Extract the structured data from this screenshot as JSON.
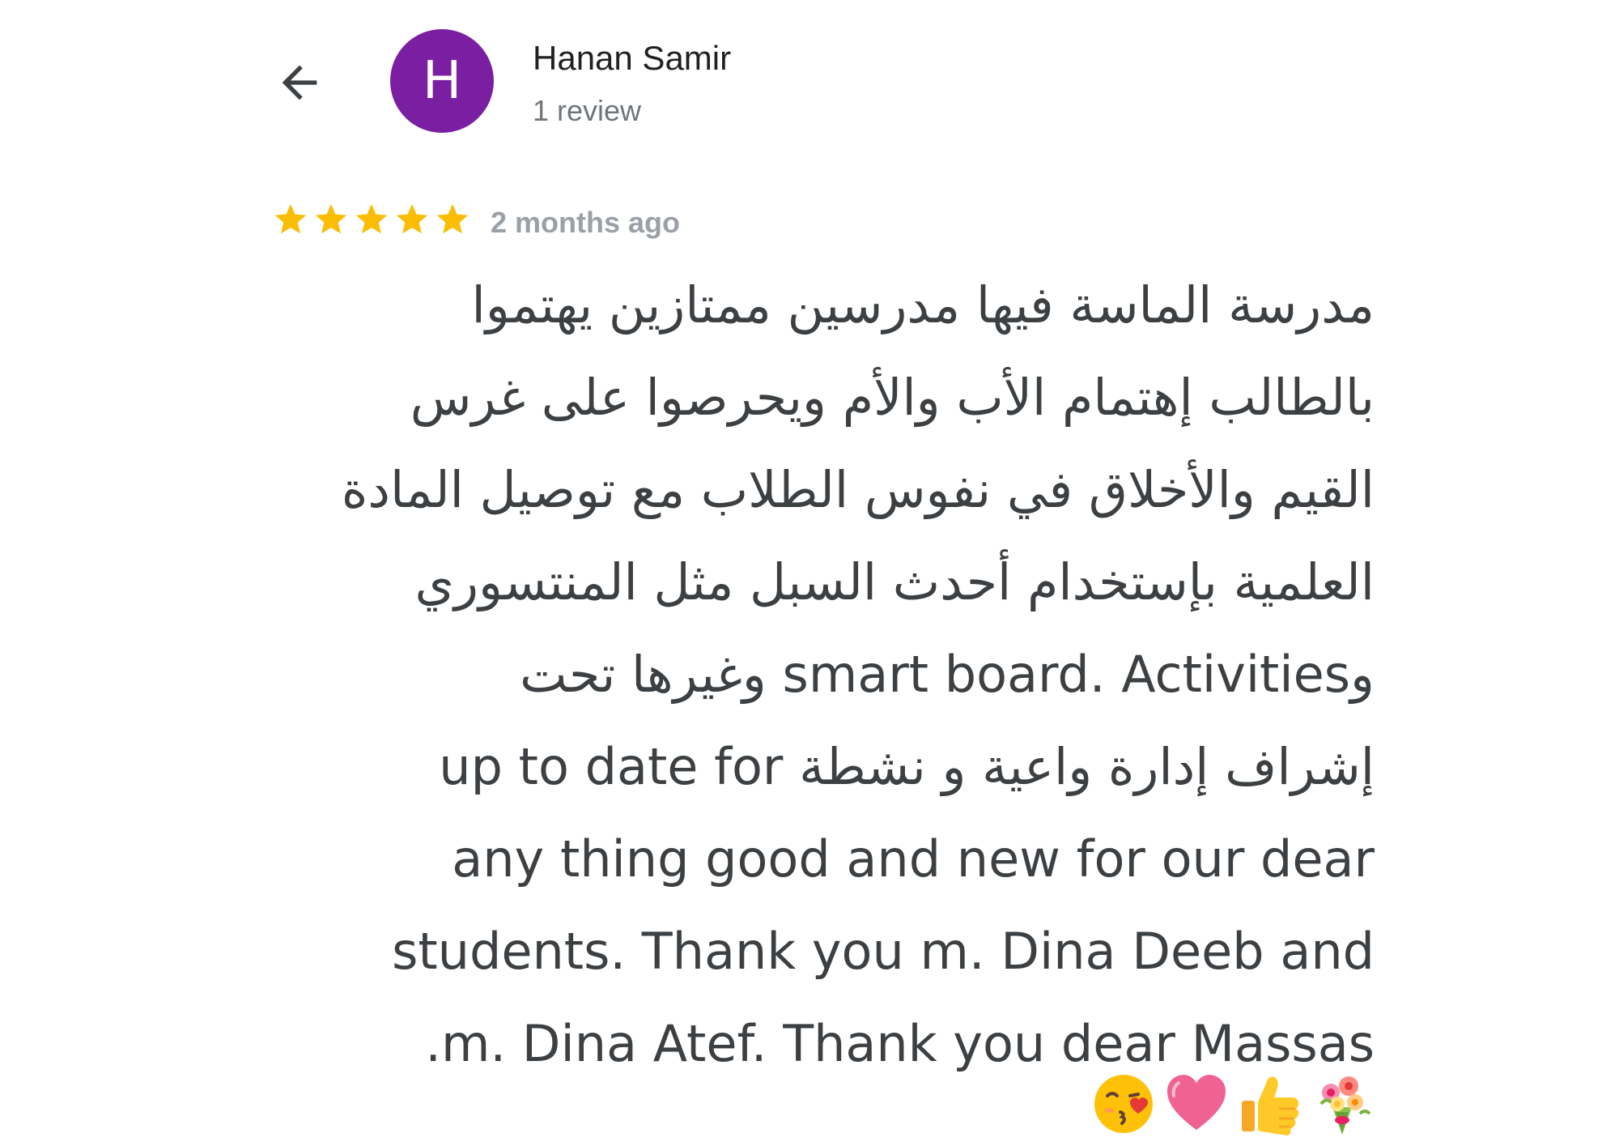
{
  "header": {
    "back_icon": "arrow-left-icon",
    "avatar_letter": "H",
    "avatar_color": "#7b1fa2",
    "reviewer_name": "Hanan Samir",
    "review_count": "1 review"
  },
  "review": {
    "rating": 5,
    "rating_max": 5,
    "star_color": "#fbbc04",
    "time": "2 months ago",
    "lines": [
      "مدرسة الماسة فيها مدرسين ممتازين يهتموا",
      "بالطالب إهتمام الأب والأم ويحرصوا على غرس",
      "القيم والأخلاق في نفوس الطلاب مع توصيل المادة",
      "العلمية بإستخدام أحدث السبل مثل المنتسوري",
      "وsmart board. Activities وغيرها تحت",
      "إشراف إدارة واعية و نشطة up to date for",
      "any thing good and new for our dear",
      "students. Thank you m. Dina Deeb and",
      ".m. Dina Atef. Thank you dear Massas"
    ],
    "emojis": [
      "bouquet-icon",
      "thumbs-up-icon",
      "heart-icon",
      "kissing-face-icon"
    ]
  }
}
